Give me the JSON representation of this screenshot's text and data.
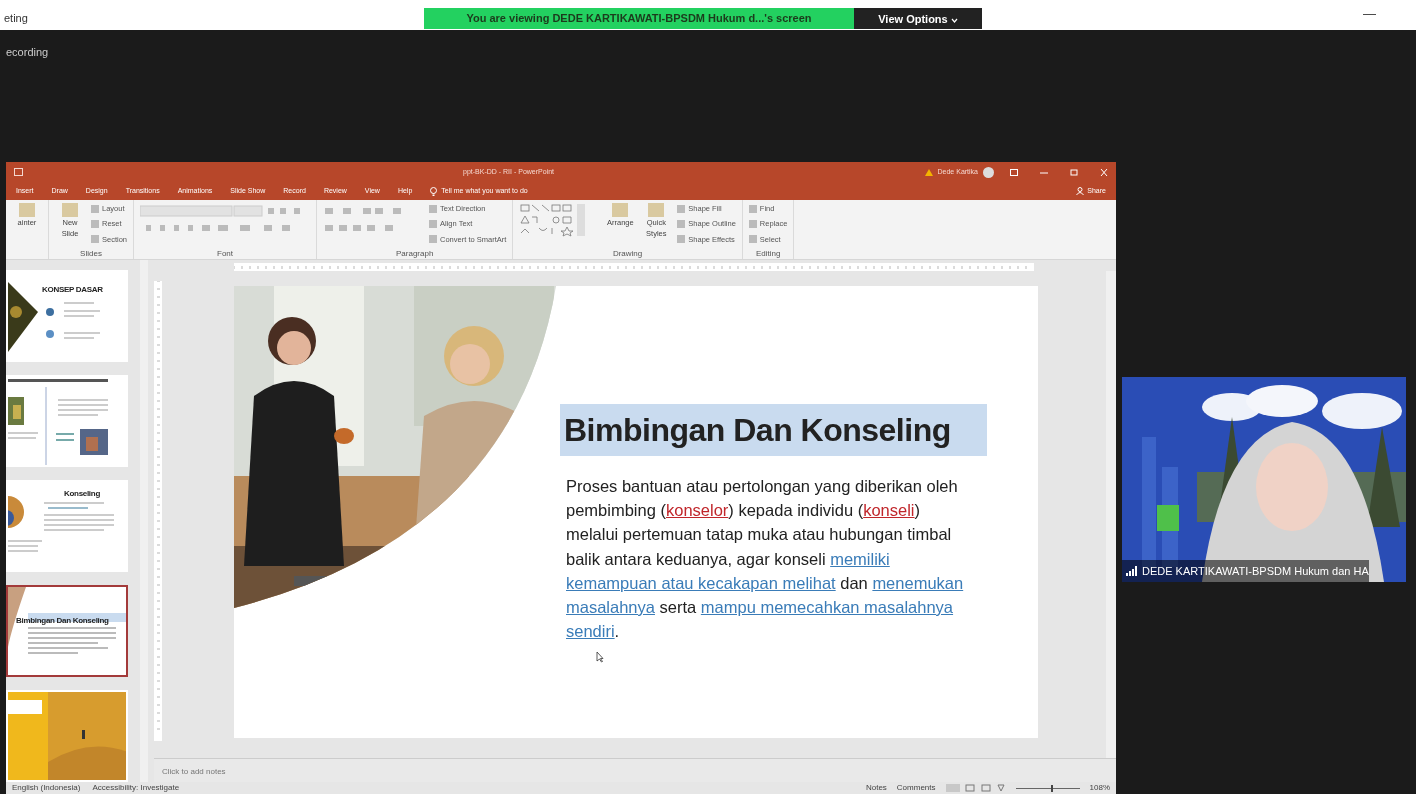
{
  "meeting": {
    "window_title": "eting",
    "banner": "You are viewing DEDE KARTIKAWATI-BPSDM Hukum d...'s screen",
    "view_options": "View Options",
    "minimize": "—",
    "recording": "ecording"
  },
  "powerpoint": {
    "title": "ppt-BK-DD - RII - PowerPoint",
    "user": "Dede Kartika",
    "share": "Share",
    "tabs": [
      "Insert",
      "Draw",
      "Design",
      "Transitions",
      "Animations",
      "Slide Show",
      "Record",
      "Review",
      "View",
      "Help"
    ],
    "tell_me": "Tell me what you want to do",
    "ribbon_groups": [
      {
        "kind": "plain",
        "large": [
          "ainter"
        ]
      },
      {
        "kind": "plain",
        "label": "Slides",
        "large": [
          "New Slide"
        ],
        "small": [
          "Layout",
          "Reset",
          "Section"
        ]
      },
      {
        "kind": "font",
        "label": "Font"
      },
      {
        "kind": "paragraph",
        "label": "Paragraph",
        "small": [
          "Text Direction",
          "Align Text",
          "Convert to SmartArt"
        ]
      },
      {
        "kind": "drawing",
        "label": "Drawing",
        "large": [
          "Arrange",
          "Quick Styles"
        ],
        "small": [
          "Shape Fill",
          "Shape Outline",
          "Shape Effects"
        ]
      },
      {
        "kind": "plain",
        "label": "Editing",
        "small": [
          "Find",
          "Replace",
          "Select"
        ]
      }
    ],
    "thumbnails": [
      {
        "kind": "photo-left",
        "title": "KONSEP DASAR",
        "selected": false
      },
      {
        "kind": "two-photos",
        "selected": false
      },
      {
        "kind": "circle",
        "title": "Konseling",
        "selected": false
      },
      {
        "kind": "highlight",
        "title": "Bimbingan Dan Konseling",
        "selected": true
      },
      {
        "kind": "desert",
        "selected": false
      }
    ],
    "slide": {
      "title": "Bimbingan Dan Konseling",
      "paragraph": [
        {
          "kind": "plain",
          "text": "Proses bantuan atau pertolongan yang diberikan oleh pembimbing ("
        },
        {
          "kind": "red",
          "text": "konselor"
        },
        {
          "kind": "plain",
          "text": ") kepada individu ("
        },
        {
          "kind": "red",
          "text": "konseli"
        },
        {
          "kind": "plain",
          "text": ") melalui pertemuan tatap muka atau hubungan timbal balik antara keduanya, agar konseli "
        },
        {
          "kind": "blue",
          "text": "memiliki kemampuan atau kecakapan melihat"
        },
        {
          "kind": "plain",
          "text": " dan "
        },
        {
          "kind": "blue",
          "text": "menemukan masalahnya"
        },
        {
          "kind": "plain",
          "text": " serta "
        },
        {
          "kind": "blue",
          "text": "mampu memecahkan masalahnya sendiri"
        },
        {
          "kind": "plain",
          "text": "."
        }
      ]
    },
    "notes_placeholder": "Click to add notes",
    "status": {
      "language": "English (Indonesia)",
      "accessibility": "Accessibility: Investigate",
      "notes": "Notes",
      "comments": "Comments",
      "zoom": "108%",
      "zoom_level": {
        "level": 0.55
      }
    }
  },
  "video": {
    "name": "DEDE KARTIKAWATI-BPSDM Hukum dan HA"
  }
}
